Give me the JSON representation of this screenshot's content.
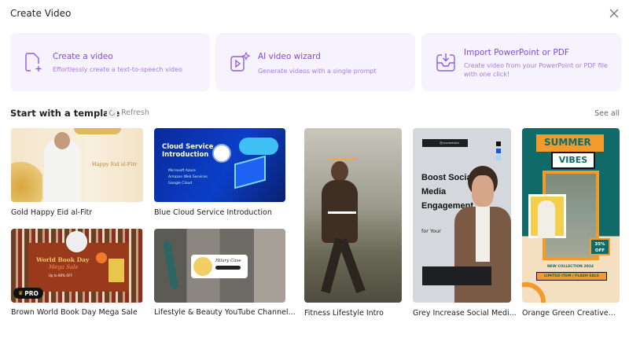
{
  "header": {
    "title": "Create Video"
  },
  "cards": [
    {
      "title": "Create a video",
      "subtitle": "Effortlessly create a text-to-speech video"
    },
    {
      "title": "AI video wizard",
      "subtitle": "Generate videos with a single prompt"
    },
    {
      "title": "Import PowerPoint or PDF",
      "subtitle": "Create video from your PowerPoint or PDF file with one click!"
    }
  ],
  "templates_section": {
    "heading": "Start with a template",
    "refresh": "Refresh",
    "see_all": "See all"
  },
  "templates": [
    {
      "label": "Gold Happy Eid al-Fitr",
      "thumb_text": "Happy Eid al-Fitr"
    },
    {
      "label": "Blue Cloud Service Introduction",
      "thumb_text": "Cloud Service Introduction",
      "thumb_items": [
        "Microsoft Azure",
        "Amazon Web Services",
        "Google Cloud"
      ]
    },
    {
      "label": "Brown World Book Day Mega Sale",
      "thumb_text": "World Book Day",
      "thumb_sub": "Mega Sale",
      "thumb_offer": "Up to 80% OFF",
      "badge": "PRO"
    },
    {
      "label": "Lifestyle & Beauty YouTube Channel...",
      "thumb_text": "Hilary Case"
    },
    {
      "label": "Fitness Lifestyle Intro"
    },
    {
      "label": "Grey Increase Social Medi...",
      "thumb_text": "Boost Social Media Engagement",
      "thumb_sub": "for Your",
      "thumb_handle": "@yourwebsite"
    },
    {
      "label": "Orange Green Creative...",
      "thumb_text": "SUMMER",
      "thumb_sub": "VIBES",
      "thumb_collection": "NEW COLLECTION 2024",
      "thumb_sale": "LIMITED ITEM / FLASH SALE",
      "thumb_offer": "35% OFF"
    }
  ],
  "colors": {
    "accent": "#7c4ddb",
    "card_bg": "#f7f3fe"
  }
}
